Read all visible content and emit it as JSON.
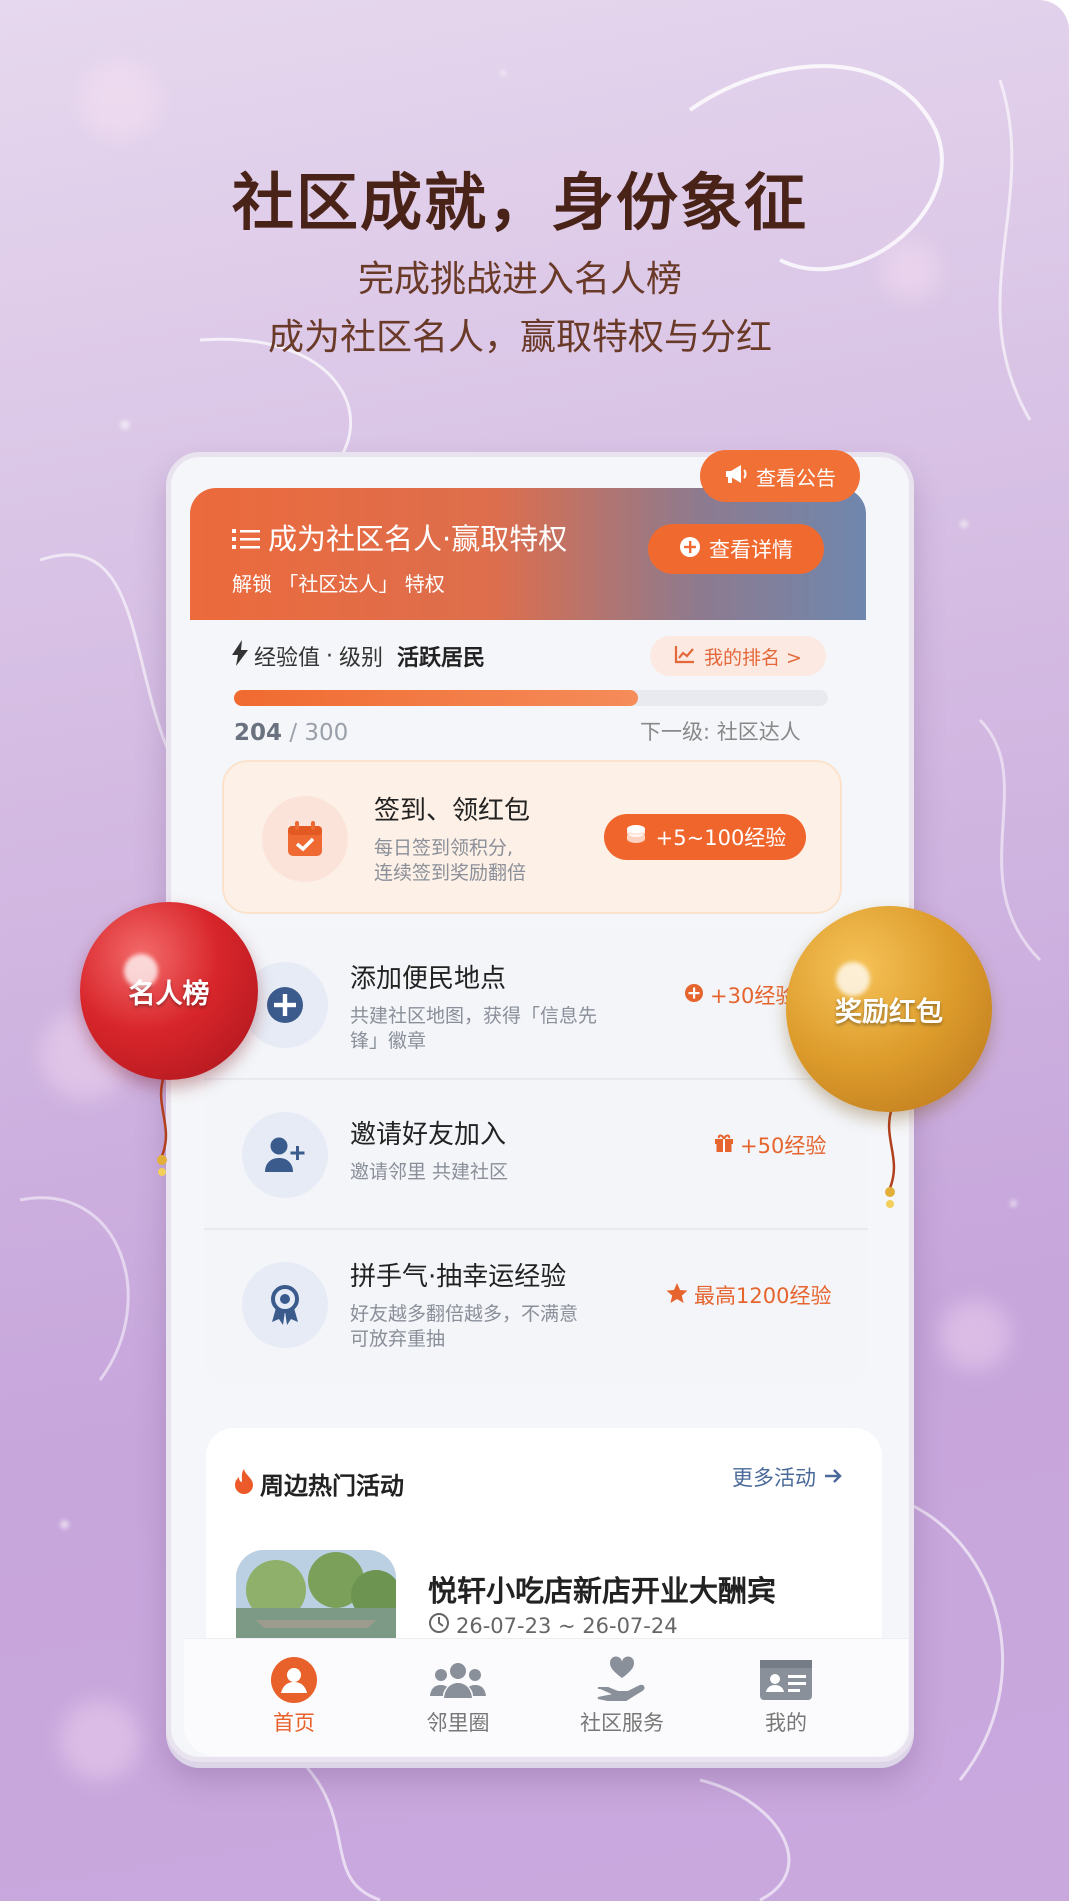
{
  "colors": {
    "accent": "#f06a30",
    "headline": "#4a2318",
    "link": "#4a6a9a",
    "balloon_red": "#d8262b",
    "balloon_gold": "#dc9b2b"
  },
  "promo": {
    "headline": "社区成就，身份象征",
    "sub1": "完成挑战进入名人榜",
    "sub2": "成为社区名人，赢取特权与分红"
  },
  "notice": {
    "label": "查看公告",
    "icon": "megaphone-icon"
  },
  "banner": {
    "title": "成为社区名人·赢取特权",
    "subtitle": "解锁 「社区达人」 特权",
    "detail_button": "查看详情",
    "icon": "list-icon"
  },
  "experience": {
    "label": "经验值",
    "separator": "·",
    "level_prefix": "级别",
    "level": "活跃居民",
    "rank_button": "我的排名 >",
    "current": "204",
    "total": "/ 300",
    "progress": 0.68,
    "next_level": "下一级: 社区达人"
  },
  "signin": {
    "title": "签到、领红包",
    "desc_line1": "每日签到领积分,",
    "desc_line2": "连续签到奖励翻倍",
    "reward": "+5~100经验",
    "icon": "calendar-check-icon"
  },
  "tasks": [
    {
      "title": "添加便民地点",
      "desc_line1": "共建社区地图，获得「信息先",
      "desc_line2": "锋」徽章",
      "reward": "+30经验",
      "icon": "plus-circle-icon"
    },
    {
      "title": "邀请好友加入",
      "desc_line1": "邀请邻里 共建社区",
      "desc_line2": "",
      "reward": "+50经验",
      "icon": "user-plus-icon"
    },
    {
      "title": "拼手气·抽幸运经验",
      "desc_line1": "好友越多翻倍越多，不满意",
      "desc_line2": "可放弃重抽",
      "reward": "最高1200经验",
      "icon": "award-icon"
    }
  ],
  "hot": {
    "title": "周边热门活动",
    "more": "更多活动",
    "event_title": "悦轩小吃店新店开业大酬宾",
    "event_time": "26-07-23 ~ 26-07-24"
  },
  "nav": [
    {
      "label": "首页",
      "icon": "home-user-icon",
      "active": true
    },
    {
      "label": "邻里圈",
      "icon": "users-icon",
      "active": false
    },
    {
      "label": "社区服务",
      "icon": "hand-heart-icon",
      "active": false
    },
    {
      "label": "我的",
      "icon": "id-card-icon",
      "active": false
    }
  ],
  "balloons": {
    "left": "名人榜",
    "right": "奖励红包"
  }
}
